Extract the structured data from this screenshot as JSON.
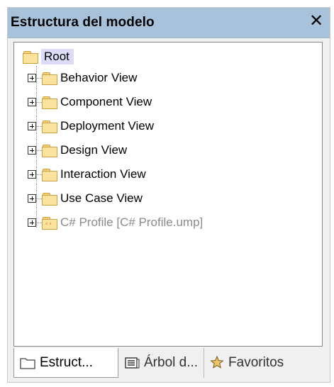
{
  "window": {
    "title": "Estructura del modelo",
    "close_symbol": "✕"
  },
  "tree": {
    "root": {
      "label": "Root",
      "icon": "folder-icon"
    },
    "items": [
      {
        "label": "Behavior View",
        "icon": "folder-icon",
        "greyed": false
      },
      {
        "label": "Component View",
        "icon": "folder-icon",
        "greyed": false
      },
      {
        "label": "Deployment View",
        "icon": "folder-icon",
        "greyed": false
      },
      {
        "label": "Design View",
        "icon": "folder-icon",
        "greyed": false
      },
      {
        "label": "Interaction View",
        "icon": "folder-icon",
        "greyed": false
      },
      {
        "label": "Use Case View",
        "icon": "folder-icon",
        "greyed": false
      },
      {
        "label": "C# Profile [C# Profile.ump]",
        "icon": "profile-folder-icon",
        "greyed": true
      }
    ]
  },
  "tabs": [
    {
      "label": "Estruct...",
      "icon": "folder-outline-icon",
      "active": true
    },
    {
      "label": "Árbol d...",
      "icon": "tree-list-icon",
      "active": false
    },
    {
      "label": "Favoritos",
      "icon": "star-icon",
      "active": false
    }
  ],
  "colors": {
    "titlebar": "#a9c2dc",
    "root_highlight": "#dcdcf8",
    "folder_fill": "#fbe39f",
    "grey_text": "#8a8a8a"
  }
}
